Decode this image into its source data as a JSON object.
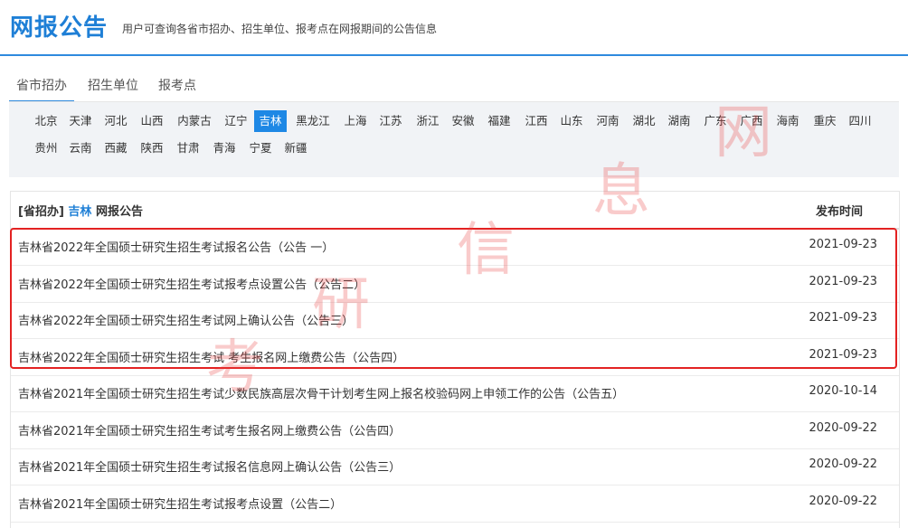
{
  "header": {
    "title": "网报公告",
    "subtitle": "用户可查询各省市招办、招生单位、报考点在网报期间的公告信息"
  },
  "tabs": [
    "省市招办",
    "招生单位",
    "报考点"
  ],
  "provinces_row1": [
    "北京",
    "天津",
    "河北",
    "山西",
    "内蒙古",
    "辽宁",
    "吉林",
    "黑龙江",
    "上海",
    "江苏",
    "浙江",
    "安徽",
    "福建",
    "江西",
    "山东",
    "河南",
    "湖北",
    "湖南",
    "广东",
    "广西",
    "海南",
    "重庆",
    "四川"
  ],
  "provinces_row2": [
    "贵州",
    "云南",
    "西藏",
    "陕西",
    "甘肃",
    "青海",
    "宁夏",
    "新疆"
  ],
  "selected_province": "吉林",
  "table": {
    "header_prefix": "[省招办]",
    "header_province": "吉林",
    "header_suffix": "网报公告",
    "date_header": "发布时间",
    "rows": [
      {
        "title": "吉林省2022年全国硕士研究生招生考试报名公告（公告 一）",
        "date": "2021-09-23"
      },
      {
        "title": "吉林省2022年全国硕士研究生招生考试报考点设置公告（公告二）",
        "date": "2021-09-23"
      },
      {
        "title": "吉林省2022年全国硕士研究生招生考试网上确认公告（公告三）",
        "date": "2021-09-23"
      },
      {
        "title": "吉林省2022年全国硕士研究生招生考试 考生报名网上缴费公告（公告四）",
        "date": "2021-09-23"
      },
      {
        "title": "吉林省2021年全国硕士研究生招生考试少数民族高层次骨干计划考生网上报名校验码网上申领工作的公告（公告五）",
        "date": "2020-10-14"
      },
      {
        "title": "吉林省2021年全国硕士研究生招生考试考生报名网上缴费公告（公告四）",
        "date": "2020-09-22"
      },
      {
        "title": "吉林省2021年全国硕士研究生招生考试报名信息网上确认公告（公告三）",
        "date": "2020-09-22"
      },
      {
        "title": "吉林省2021年全国硕士研究生招生考试报考点设置（公告二）",
        "date": "2020-09-22"
      }
    ]
  },
  "watermark": [
    "考",
    "研",
    "信",
    "息",
    "网"
  ],
  "colors": {
    "accent": "#1e7fd6",
    "highlight_box": "#e32222",
    "selected_bg": "#1e88e5"
  }
}
